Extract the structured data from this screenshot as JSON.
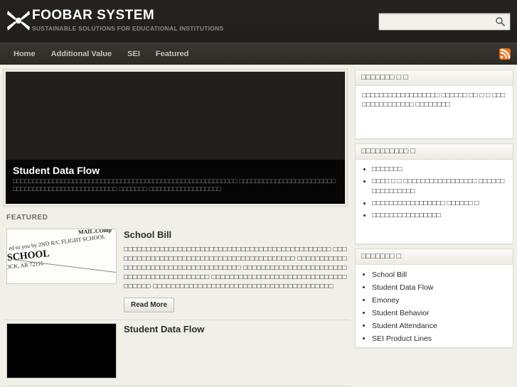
{
  "header": {
    "logo_icon": "x-star-logo-icon",
    "brand_title": "FOOBAR SYSTEM",
    "tagline": "SUSTAINABLE SOLUTIONS FOR EDUCATIONAL INSTITUTIONS",
    "search": {
      "value": "",
      "placeholder": "",
      "icon": "search-icon"
    }
  },
  "nav": {
    "items": [
      {
        "label": "Home"
      },
      {
        "label": "Additional Value"
      },
      {
        "label": "SEI"
      },
      {
        "label": "Featured"
      }
    ],
    "rss_icon": "rss-feed-icon"
  },
  "hero": {
    "title": "Student Data Flow",
    "excerpt": "□□□□□□□□□□□□□□□□□□□□□□□□□□□□□□□□□□□□□□□□□□□□□□□□□□□□□□□□ □□□□□□□□□□□□□□□□□□□□□□□□□□□□□□□□□□□□□□□□□□□□□□□□□□ □□□□□□□ □□□□□□□□□□□□□□□□□□"
  },
  "featured": {
    "section_label": "FEATURED",
    "articles": [
      {
        "title": "School Bill",
        "thumbnail_type": "scanned-document",
        "thumbnail_text": {
          "line1": "MAIL.COmp",
          "line2": "ed to you by 2ND R/C FLIGHT SCHOOL",
          "line3": "SCHOOL",
          "line4": "OCK, AR 72116"
        },
        "excerpt": "□□□□□□□□□□□□□□□□□□□□□□□□□□□□□□□□□□□□□□□□□□□□□□ □□□□□□□□□□□□□□□□□□□□□□□□□□□□□□□□□□□□□□□□□ □□□□□□□□□□□□□□□□□□□□□□□□□□□□□□□□□□□□□ □□□□□□□□□□□□□□□□□□□□□□□□□□□□□□□□□□□□□□□□□□ □□□□□□□□□□□□□□□□□□□□□□□□□□□□□□□□□□□□ □□□□□□□□□□□□□□□□□□□□□□□□□□□□□□□□□□□□□□□□",
        "read_more_label": "Read More"
      },
      {
        "title": "Student Data Flow",
        "thumbnail_type": "dark-image",
        "excerpt": ""
      }
    ]
  },
  "sidebar": {
    "widgets": [
      {
        "id": "widget-one",
        "title": "□□□□□□□ □ □",
        "body": "□□□□□□□□□□□□□□□□□□ □□□□□□ □□ □ □ □□□□□□□□□□□□□□□ □□□□□□□□",
        "type": "text"
      },
      {
        "id": "widget-two",
        "title": "□□□□□□□□□□ □",
        "type": "list",
        "items": [
          "□□□□□□□",
          "□□□□ □ □ □□□□□□□□□□□□□□□□□ □□□□□□□□□□□□□□□□",
          "□□□□□□□□□□□□□□□□□ □□□□□□ □",
          "□□□□□□□□□□□□□□□□"
        ]
      },
      {
        "id": "widget-three",
        "title": "□□□□□□□ □",
        "type": "links",
        "items": [
          "School Bill",
          "Student Data Flow",
          "Emoney",
          "Student Behavior",
          "Student Attendance",
          "SEI Product Lines"
        ]
      }
    ]
  },
  "colors": {
    "header_bg": "#231f1d",
    "nav_bg": "#35302c",
    "page_bg": "#f0efe8",
    "rss_orange": "#ea7321",
    "caption_bg": "#060606",
    "text_dark": "#2b2b2b"
  }
}
